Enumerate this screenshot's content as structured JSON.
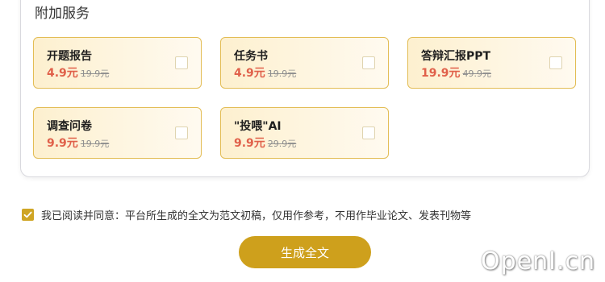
{
  "section": {
    "title": "附加服务"
  },
  "services": [
    {
      "name": "开题报告",
      "price": "4.9元",
      "original": "19.9元"
    },
    {
      "name": "任务书",
      "price": "4.9元",
      "original": "19.9元"
    },
    {
      "name": "答辩汇报PPT",
      "price": "19.9元",
      "original": "49.9元"
    },
    {
      "name": "调查问卷",
      "price": "9.9元",
      "original": "19.9元"
    },
    {
      "name": "\"投喂\"AI",
      "price": "9.9元",
      "original": "29.9元"
    }
  ],
  "agreement": {
    "checked": true,
    "text": "我已阅读并同意：平台所生成的全文为范文初稿，仅用作参考，不用作毕业论文、发表刊物等"
  },
  "actions": {
    "generate_label": "生成全文"
  },
  "watermark": "OpenI.cn",
  "colors": {
    "accent": "#cea01c",
    "price": "#e0604a",
    "card_border": "#e3bd55"
  }
}
